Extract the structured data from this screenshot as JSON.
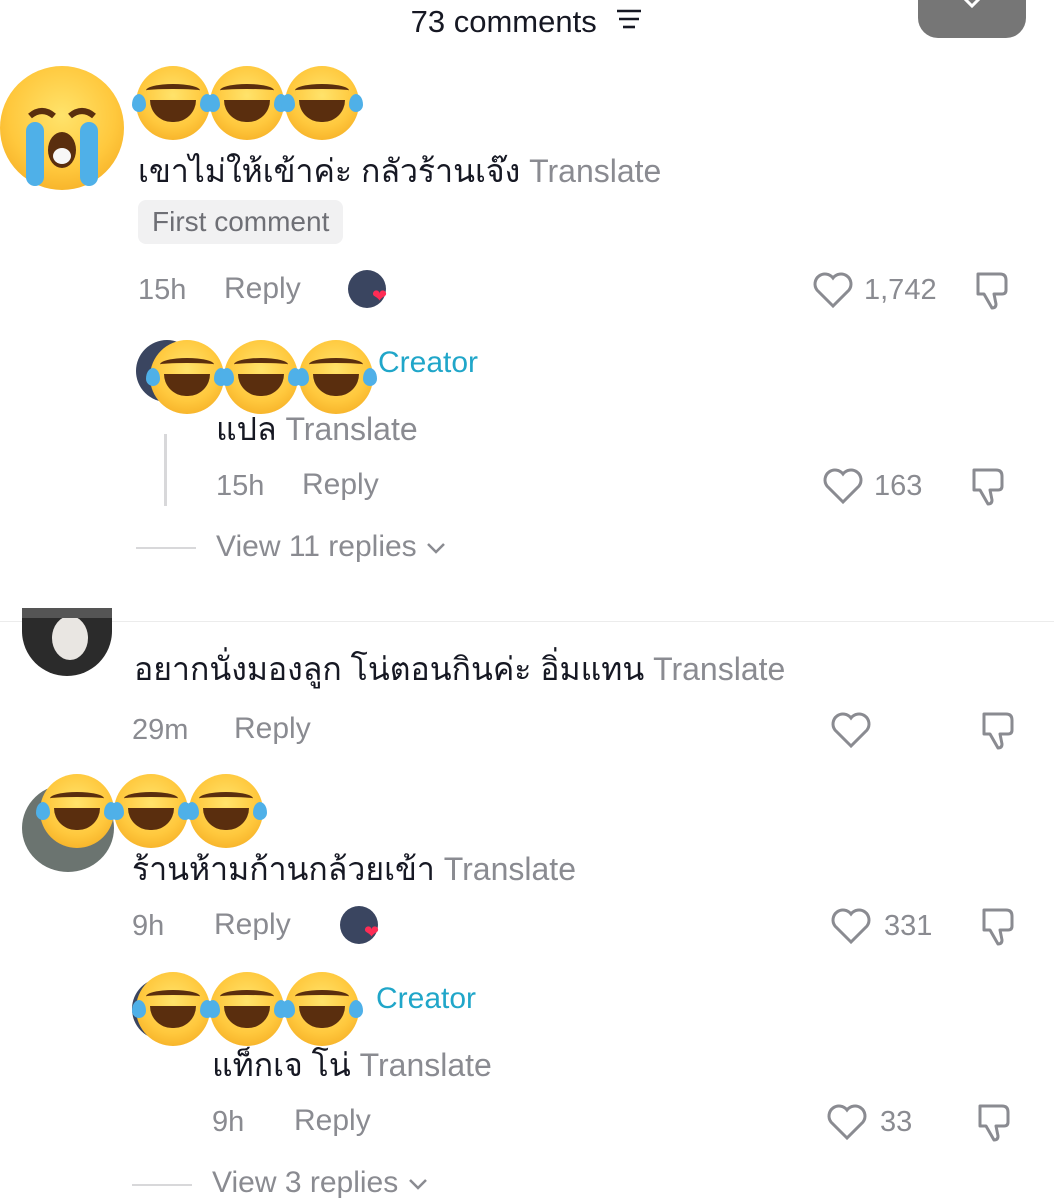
{
  "header": {
    "title": "73 comments",
    "sort_icon": "sort-lines-icon"
  },
  "comments": [
    {
      "emojis": "😂😂😂",
      "text": "เขาไม่ให้เข้าค่ะ กลัวร้านเจ๊ง",
      "translate": "Translate",
      "badge": "First comment",
      "time": "15h",
      "reply": "Reply",
      "likes": "1,742",
      "reply_item": {
        "creator": "Creator",
        "text": "แปล",
        "translate": "Translate",
        "time": "15h",
        "reply": "Reply",
        "likes": "163"
      },
      "view_replies": "View 11 replies"
    },
    {
      "text": "อยากนั่งมองลูก โน่ตอนกินค่ะ อิ่มแทน",
      "translate": "Translate",
      "time": "29m",
      "reply": "Reply"
    },
    {
      "emojis": "😂😂😂",
      "text": "ร้านห้ามก้านกล้วยเข้า",
      "translate": "Translate",
      "time": "9h",
      "reply": "Reply",
      "likes": "331",
      "reply_item": {
        "creator": "Creator",
        "text": "แท็กเจ โน่",
        "translate": "Translate",
        "time": "9h",
        "reply": "Reply",
        "likes": "33"
      },
      "view_replies": "View 3 replies"
    }
  ],
  "colors": {
    "creator": "#20a6c9",
    "muted": "#8a8b91",
    "text": "#161823",
    "heart": "#fe2c55"
  }
}
